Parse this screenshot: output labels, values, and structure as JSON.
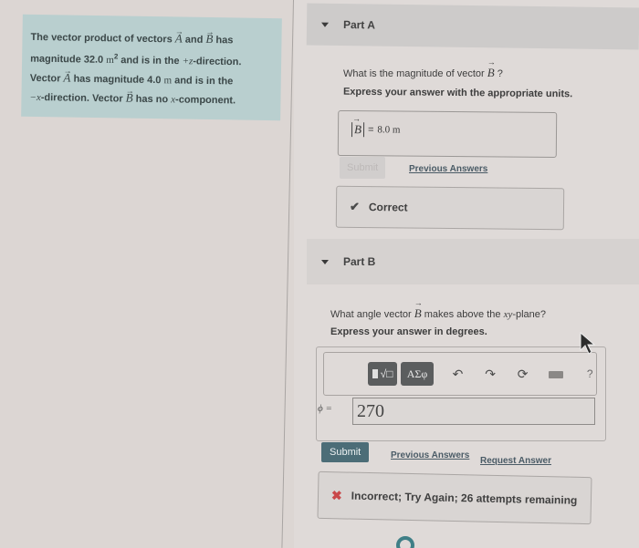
{
  "problem": {
    "line1_pre": "The vector product of vectors ",
    "vec_a": "A",
    "and": " and ",
    "vec_b": "B",
    "line1_post": " has",
    "line2_pre": "magnitude 32.0 ",
    "unit_m": "m",
    "sup2": "2",
    "line2_post": " and is in the ",
    "plus_z": "+z",
    "line2_end": "-direction.",
    "line3_pre": "Vector ",
    "line3_post": " has magnitude 4.0 ",
    "line3_end": " and is in the",
    "minus_x": "−x",
    "line4_mid": "-direction. Vector ",
    "line4_post": " has no ",
    "x_var": "x",
    "line4_end": "-component."
  },
  "part_a": {
    "title": "Part A",
    "question_pre": "What is the magnitude of vector ",
    "question_vec": "B",
    "question_post": " ?",
    "instruction": "Express your answer with the appropriate units.",
    "answer_lhs": "B",
    "answer_eq": "=",
    "answer_value": "8.0 m",
    "submit_label": "Submit",
    "previous_answers_label": "Previous Answers",
    "feedback_icon": "check-icon",
    "feedback_text": "Correct"
  },
  "part_b": {
    "title": "Part B",
    "question_pre": "What angle vector ",
    "question_vec": "B",
    "question_mid": " makes above the ",
    "question_plane": "xy",
    "question_post": "-plane?",
    "instruction": "Express your answer in degrees.",
    "toolbar": {
      "templates_label": "√□",
      "symbols_label": "ΑΣφ",
      "undo": "undo-icon",
      "redo": "redo-icon",
      "reset": "reset-icon",
      "keyboard": "keyboard-icon",
      "help_label": "?"
    },
    "answer_lhs": "ϕ =",
    "answer_value": "270",
    "submit_label": "Submit",
    "previous_answers_label": "Previous Answers",
    "request_answer_label": "Request Answer",
    "feedback_icon": "x-icon",
    "feedback_text": "Incorrect; Try Again; 26 attempts remaining"
  },
  "colors": {
    "problem_bg": "#b9cfcf",
    "submit_active": "#4c6d77",
    "correct_check": "#4a4a4a",
    "incorrect_x": "#c9484a"
  }
}
